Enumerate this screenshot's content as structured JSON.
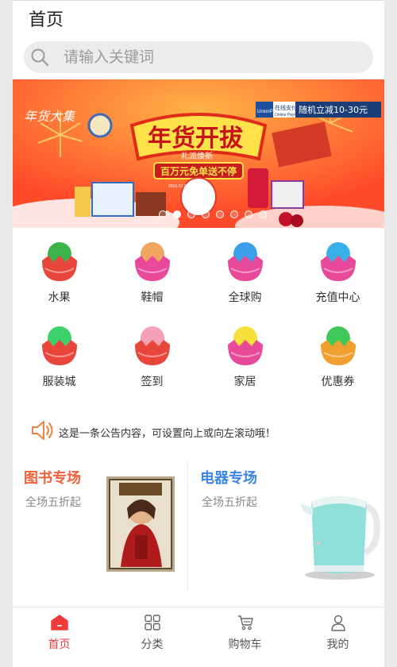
{
  "header": {
    "title": "首页"
  },
  "search": {
    "placeholder": "请输入关键词"
  },
  "banner": {
    "corner_text": "年货大集",
    "headline": "年货开拔",
    "subhead": "礼派焕新",
    "offer": "百万元免单送不停",
    "date_range": "2016.12.26-2017.1.2",
    "pay_brand": "UnionPay",
    "pay_label": "在线支付",
    "pay_label_en": "Online Payment",
    "pay_offer": "随机立减10-30元",
    "slide_count": 8,
    "active_slide": 1
  },
  "categories": [
    {
      "label": "水果",
      "icon": "watermelon-icon"
    },
    {
      "label": "鞋帽",
      "icon": "chicken-icon"
    },
    {
      "label": "全球购",
      "icon": "globe-icon"
    },
    {
      "label": "充值中心",
      "icon": "robot-icon"
    },
    {
      "label": "服装城",
      "icon": "clothes-box-icon"
    },
    {
      "label": "签到",
      "icon": "piggy-bank-icon"
    },
    {
      "label": "家居",
      "icon": "home-goods-icon"
    },
    {
      "label": "优惠券",
      "icon": "coupon-icon"
    }
  ],
  "notice": {
    "text": "这是一条公告内容，可设置向上或向左滚动哦！",
    "icon": "speaker-icon"
  },
  "promos": [
    {
      "title": "图书专场",
      "subtitle": "全场五折起",
      "color": "#f2603a",
      "image": "book-image"
    },
    {
      "title": "电器专场",
      "subtitle": "全场五折起",
      "color": "#3a85e6",
      "image": "kettle-image"
    }
  ],
  "tabs": [
    {
      "label": "首页",
      "icon": "home-icon",
      "active": true
    },
    {
      "label": "分类",
      "icon": "category-grid-icon"
    },
    {
      "label": "购物车",
      "icon": "cart-icon"
    },
    {
      "label": "我的",
      "icon": "user-icon"
    }
  ],
  "colors": {
    "accent": "#f03a3a",
    "search_bg": "#ececec"
  }
}
